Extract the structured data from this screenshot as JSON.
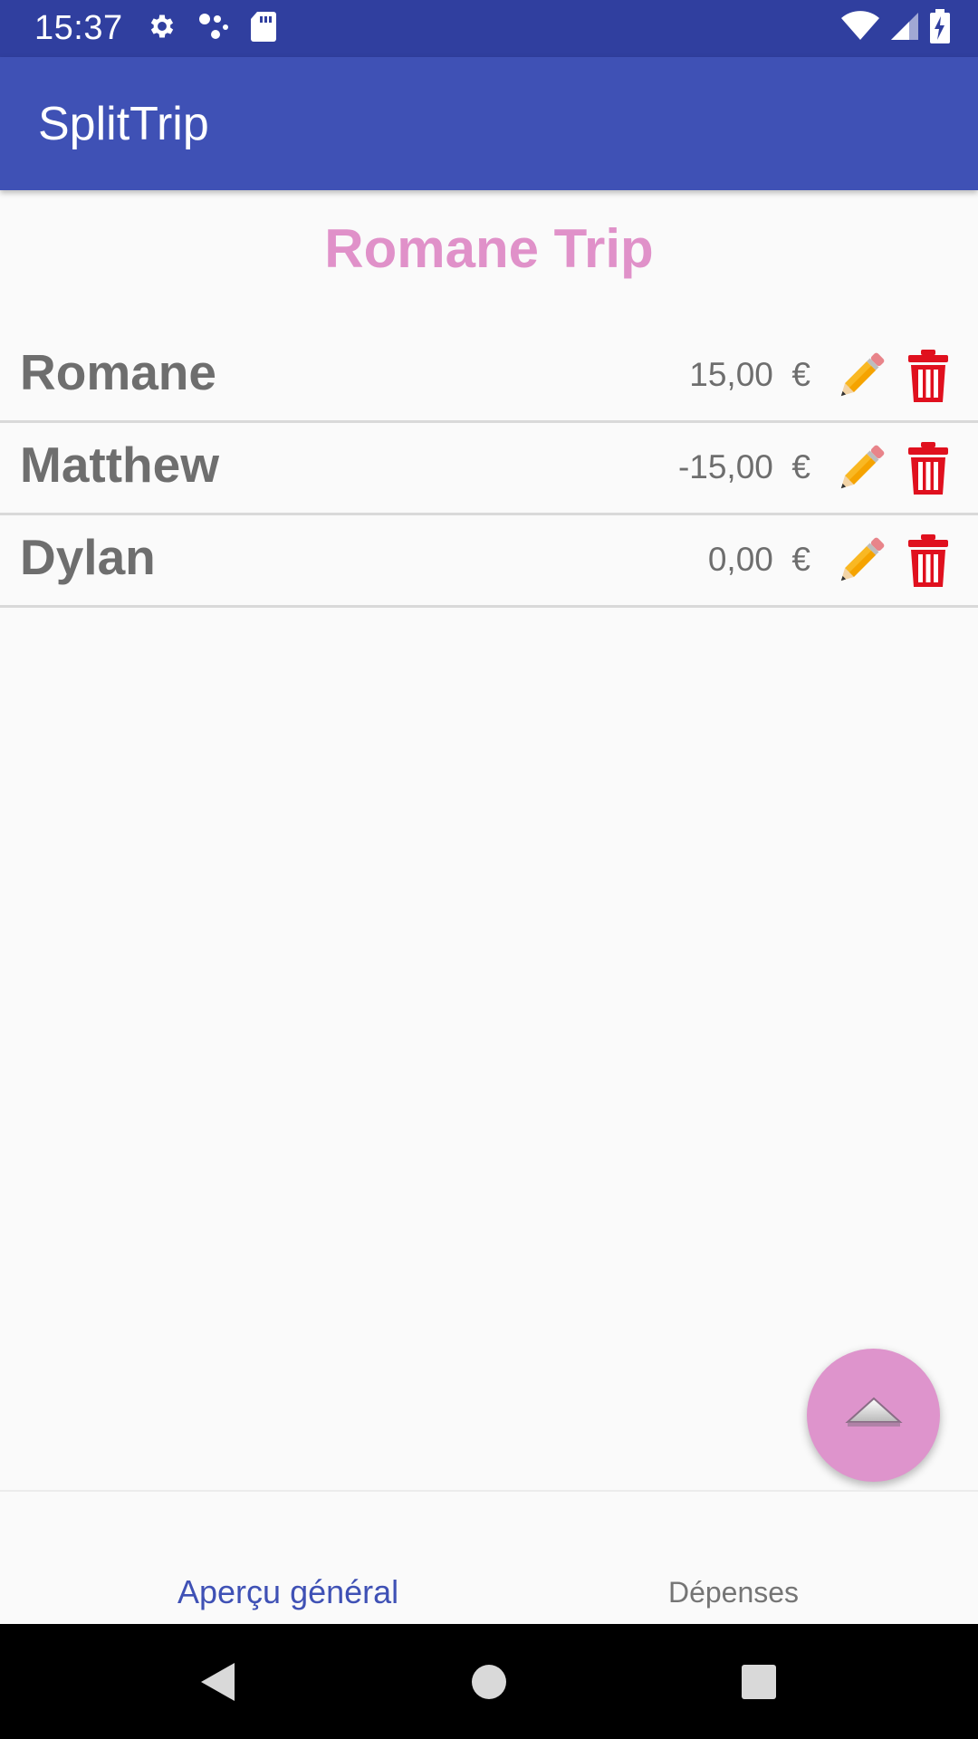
{
  "status_bar": {
    "time": "15:37",
    "left_icons": [
      "gear-icon",
      "assistant-dots-icon",
      "sd-card-icon"
    ],
    "right_icons": [
      "wifi-icon",
      "signal-icon",
      "battery-charging-icon"
    ]
  },
  "app_bar": {
    "title": "SplitTrip"
  },
  "trip": {
    "title": "Romane Trip"
  },
  "participants": [
    {
      "name": "Romane",
      "amount": "15,00  €",
      "edit_icon": "pencil-icon",
      "delete_icon": "trash-icon"
    },
    {
      "name": "Matthew",
      "amount": "-15,00  €",
      "edit_icon": "pencil-icon",
      "delete_icon": "trash-icon"
    },
    {
      "name": "Dylan",
      "amount": "0,00  €",
      "edit_icon": "pencil-icon",
      "delete_icon": "trash-icon"
    }
  ],
  "fab": {
    "icon": "chevron-up-icon"
  },
  "bottom_tabs": {
    "overview": "Aperçu général",
    "expenses": "Dépenses",
    "selected": "overview"
  },
  "colors": {
    "status_bar": "#303f9f",
    "app_bar": "#3f51b5",
    "trip_title": "#e091c9",
    "fab": "#de94cc",
    "delete": "#e0101e",
    "tab_selected": "#3f51b5"
  },
  "nav_bar": {
    "icons": [
      "back-icon",
      "home-icon",
      "recents-icon"
    ]
  }
}
